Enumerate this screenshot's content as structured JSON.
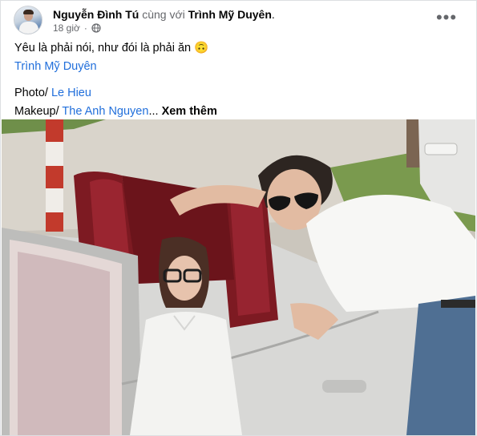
{
  "post": {
    "author": "Nguyễn Đình Tú",
    "with_text": "cùng với",
    "tagged": "Trình Mỹ Duyên",
    "period": ".",
    "time": "18 giờ",
    "more_icon": "more-horizontal-icon",
    "privacy_icon": "globe-icon"
  },
  "caption": {
    "line1_text": "Yêu là phải nói, như đói là phải ăn",
    "line1_emoji": "🙃",
    "mention": "Trình Mỹ Duyên",
    "photo_label": "Photo/",
    "photo_credit": "Le Hieu",
    "makeup_label": "Makeup/",
    "makeup_credit": "The Anh Nguyen",
    "ellipsis": "...",
    "see_more": "Xem thêm"
  },
  "colors": {
    "link": "#216fdb",
    "secondary_text": "#65676b",
    "car_seat": "#7d1a22",
    "car_body": "#d9d9d7"
  }
}
